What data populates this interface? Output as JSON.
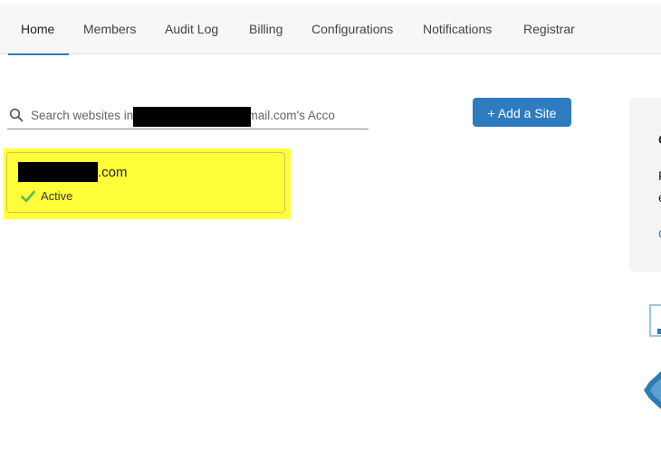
{
  "nav": {
    "tabs": [
      {
        "label": "Home",
        "active": true
      },
      {
        "label": "Members"
      },
      {
        "label": "Audit Log"
      },
      {
        "label": "Billing"
      },
      {
        "label": "Configurations"
      },
      {
        "label": "Notifications"
      },
      {
        "label": "Registrar"
      }
    ]
  },
  "search": {
    "placeholder": "Search websites in                            @gmail.com's Acco"
  },
  "actions": {
    "add_site_label": "+ Add a Site"
  },
  "sites": [
    {
      "domain_suffix": ".com",
      "status": "Active"
    }
  ],
  "side_panel": {
    "frag1": "C",
    "frag2": "F",
    "frag3": "e",
    "frag4": "C"
  },
  "colors": {
    "accent": "#2f7bbf",
    "highlight": "#ffff3a",
    "status_ok": "#5cb85c"
  },
  "icons": {
    "search": "search-icon",
    "check": "check-icon"
  }
}
